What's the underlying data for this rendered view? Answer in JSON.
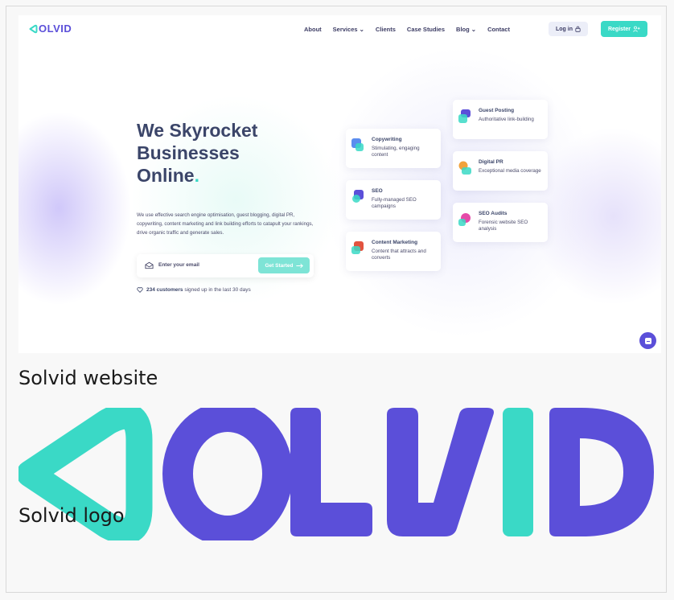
{
  "website": {
    "logo_text": "OLVID",
    "nav": [
      "About",
      "Services ⌄",
      "Clients",
      "Case Studies",
      "Blog ⌄",
      "Contact"
    ],
    "login_label": "Log in",
    "register_label": "Register",
    "headline_line1": "We Skyrocket",
    "headline_line2": "Businesses",
    "headline_line3": "Online",
    "headline_dot": ".",
    "description": "We use effective search engine optimisation, guest blogging, digital PR, copywriting, content marketing and link building efforts to catapult your rankings, drive organic traffic and generate sales.",
    "email_placeholder": "Enter your email",
    "cta_label": "Get Started",
    "signup_count": "234 customers",
    "signup_rest": "signed up in the last 30 days",
    "services": [
      {
        "title": "Copywriting",
        "desc": "Stimulating, engaging content"
      },
      {
        "title": "SEO",
        "desc": "Fully-managed SEO campaigns"
      },
      {
        "title": "Content Marketing",
        "desc": "Content that attracts and converts"
      },
      {
        "title": "Guest Posting",
        "desc": "Authoritative link-building"
      },
      {
        "title": "Digital PR",
        "desc": "Exceptional media coverage"
      },
      {
        "title": "SEO Audits",
        "desc": "Forensic website SEO analysis"
      }
    ]
  },
  "captions": {
    "website": "Solvid website",
    "logo": "Solvid logo"
  },
  "logo": {
    "text": "OLVID"
  },
  "colors": {
    "brand_purple": "#5b4fd9",
    "brand_teal": "#3ad9c6",
    "heading": "#3b4569"
  }
}
